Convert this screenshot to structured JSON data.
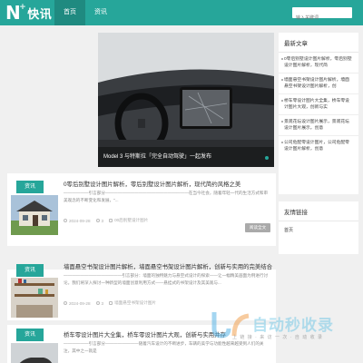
{
  "header": {
    "logo_letter": "N",
    "logo_plus": "+",
    "logo_text": "快讯",
    "nav": [
      {
        "label": "首页",
        "active": true
      },
      {
        "label": "资讯",
        "active": false
      }
    ],
    "search_placeholder": "输入关键词"
  },
  "hero": {
    "caption": "Model 3 与特斯拉「完全自动驾驶」一起发布"
  },
  "articles": [
    {
      "category": "资讯",
      "title": "0零后别墅设计图片解析，零后别墅设计图片解析，现代简约风格之美",
      "excerpt": "——————引言部分————————————————————在当今社会，随着年轻一代的生活方式和审美观念的不断变化和发展，\"...",
      "date": "2024-09-28",
      "views": "3",
      "tag": "00后别墅设计图片",
      "read_more": "阅读全文"
    },
    {
      "category": "资讯",
      "title": "墙面悬空书架设计图片解析，墙面悬空书架设计图片解析，创新与实用的完美结合",
      "excerpt": "——————————————引言部分：墙面的独特魅力与悬空式设计的探索——让一幅精美画面为例进行讨论。我们将深入探讨一种新型的墙面创意利用方式——悬挂式的书架设计及其美观与...",
      "date": "2024-09-28",
      "views": "3",
      "tag": "墙面悬空书架设计图片"
    },
    {
      "category": "资讯",
      "title": "桥车零设计图片大全集，桥车零设计图片大观，创新与实用并存",
      "excerpt": "——————引言部分————————随着汽车设计的不断进步，车辆的美学与功能性越来越受到人们的关注，其中之一就是",
      "date": "",
      "views": "",
      "tag": ""
    }
  ],
  "sidebar": {
    "recent_title": "最新文章",
    "recent": [
      "0零后别墅设计图片解析，零后别墅设计图片解析，现代简",
      "墙面悬空书架设计图片解析，墙面悬空书架设计图片解析，创",
      "桥车零设计图片大全集，桥车零设计图片大观，创新与实",
      "景观花坛设计图片展示，景观花坛设计图片展示，创意",
      "公司危配零设计图片，公司危配零设计图片解析，创意"
    ],
    "links_title": "友情链接",
    "links": [
      "首页"
    ]
  },
  "watermark": {
    "text": "自动秒收录",
    "sub": "上 链 接 · 来 访 一 次 · 自 动 收 录"
  },
  "colors": {
    "accent": "#26a69a",
    "background": "#f0f0f0"
  }
}
